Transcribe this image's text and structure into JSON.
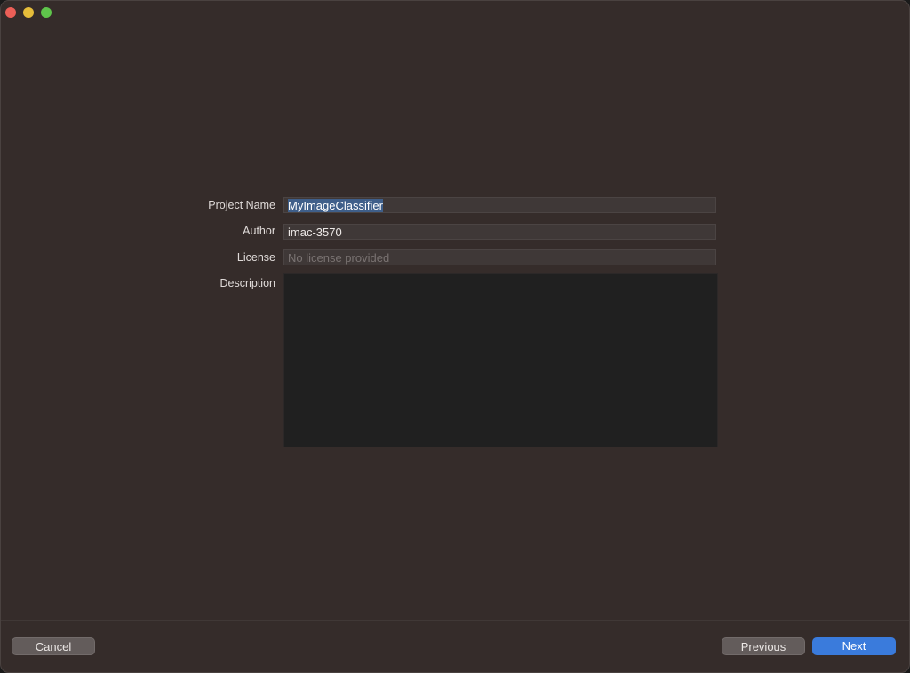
{
  "window": {
    "controls": [
      "close-button",
      "minimize-button",
      "zoom-button"
    ]
  },
  "form": {
    "project_name": {
      "label": "Project Name",
      "value": "MyImageClassifier"
    },
    "author": {
      "label": "Author",
      "value": "imac-3570"
    },
    "license": {
      "label": "License",
      "value": "",
      "placeholder": "No license provided"
    },
    "description": {
      "label": "Description",
      "value": ""
    }
  },
  "footer": {
    "cancel_label": "Cancel",
    "previous_label": "Previous",
    "next_label": "Next"
  },
  "colors": {
    "window_bg": "#352c2a",
    "accent": "#3a7bdc",
    "selection": "#3f5f8a"
  }
}
